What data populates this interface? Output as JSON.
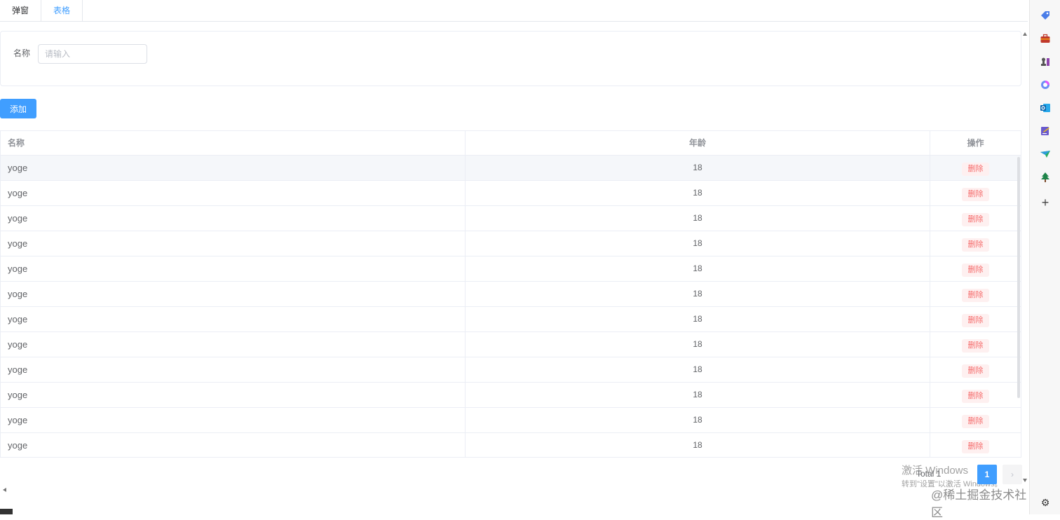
{
  "tabs": [
    {
      "label": "弹窗"
    },
    {
      "label": "表格"
    }
  ],
  "search": {
    "label": "名称",
    "placeholder": "请输入",
    "value": ""
  },
  "toolbar": {
    "add_label": "添加"
  },
  "table": {
    "columns": [
      "名称",
      "年龄",
      "操作"
    ],
    "rows": [
      {
        "name": "yoge",
        "age": "18",
        "action": "删除"
      },
      {
        "name": "yoge",
        "age": "18",
        "action": "删除"
      },
      {
        "name": "yoge",
        "age": "18",
        "action": "删除"
      },
      {
        "name": "yoge",
        "age": "18",
        "action": "删除"
      },
      {
        "name": "yoge",
        "age": "18",
        "action": "删除"
      },
      {
        "name": "yoge",
        "age": "18",
        "action": "删除"
      },
      {
        "name": "yoge",
        "age": "18",
        "action": "删除"
      },
      {
        "name": "yoge",
        "age": "18",
        "action": "删除"
      },
      {
        "name": "yoge",
        "age": "18",
        "action": "删除"
      },
      {
        "name": "yoge",
        "age": "18",
        "action": "删除"
      },
      {
        "name": "yoge",
        "age": "18",
        "action": "删除"
      },
      {
        "name": "yoge",
        "age": "18",
        "action": "删除"
      }
    ]
  },
  "pagination": {
    "total_label": "Total 1",
    "current_page": "1",
    "next_symbol": "›"
  },
  "watermarks": {
    "windows_title": "激活 Windows",
    "windows_sub": "转到\"设置\"以激活 Windows。",
    "juejin": "@稀土掘金技术社区"
  },
  "sidebar": {
    "icons": [
      "tag-icon",
      "briefcase-icon",
      "chess-icon",
      "copilot-icon",
      "outlook-icon",
      "notes-icon",
      "paper-plane-icon",
      "tree-icon"
    ],
    "plus_symbol": "+",
    "gear_symbol": "⚙"
  },
  "colors": {
    "primary": "#409eff",
    "danger": "#f56c6c",
    "danger_bg": "#fef0f0",
    "border": "#ebeef5"
  }
}
